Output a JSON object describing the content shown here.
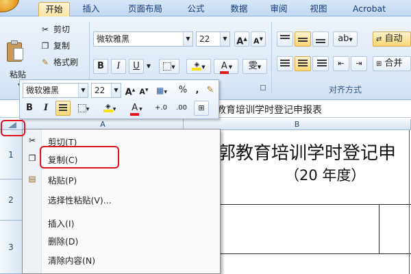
{
  "ribbon_tabs": [
    "开始",
    "插入",
    "页面布局",
    "公式",
    "数据",
    "审阅",
    "视图",
    "Acrobat"
  ],
  "clipboard": {
    "paste_label": "粘贴",
    "cut_label": "剪切",
    "copy_label": "复制",
    "format_painter_label": "格式刷"
  },
  "font": {
    "name": "微软雅黑",
    "size": "22",
    "grow_glyph": "A",
    "shrink_glyph": "A",
    "bold": "B",
    "italic": "I",
    "underline": "U",
    "font_color_glyph": "A",
    "phonetic_glyph": "雯"
  },
  "alignment": {
    "group_label": "对齐方式",
    "wrap_label": "自动",
    "merge_label": "合并"
  },
  "mini_toolbar": {
    "font_name": "微软雅黑",
    "font_size": "22",
    "grow_glyph": "A",
    "shrink_glyph": "A",
    "percent": "%",
    "comma": ",",
    "bold": "B",
    "italic": "I",
    "font_color_glyph": "A",
    "increase_decimal": "+.0",
    "decrease_decimal": ".00"
  },
  "formula_bar": {
    "content": "教育培训学时登记申报表"
  },
  "sheet": {
    "columns": [
      "A",
      "B"
    ],
    "rows": [
      "1",
      "2",
      "3"
    ],
    "title_fragment": "郭教育培训学时登记申",
    "year_text": "（20  年度）"
  },
  "context_menu": {
    "items": [
      {
        "label": "剪切(T)",
        "icon": "scissors-icon"
      },
      {
        "label": "复制(C)",
        "icon": "copy-icon"
      },
      {
        "label": "粘贴(P)",
        "icon": "paste-icon"
      },
      {
        "label": "选择性粘贴(V)...",
        "icon": ""
      },
      {
        "label": "插入(I)",
        "icon": ""
      },
      {
        "label": "删除(D)",
        "icon": ""
      },
      {
        "label": "清除内容(N)",
        "icon": ""
      }
    ]
  },
  "colors": {
    "highlight_red": "#e0101c",
    "ribbon_blue": "#dde9f7",
    "active_tab": "#fbe3a2"
  }
}
